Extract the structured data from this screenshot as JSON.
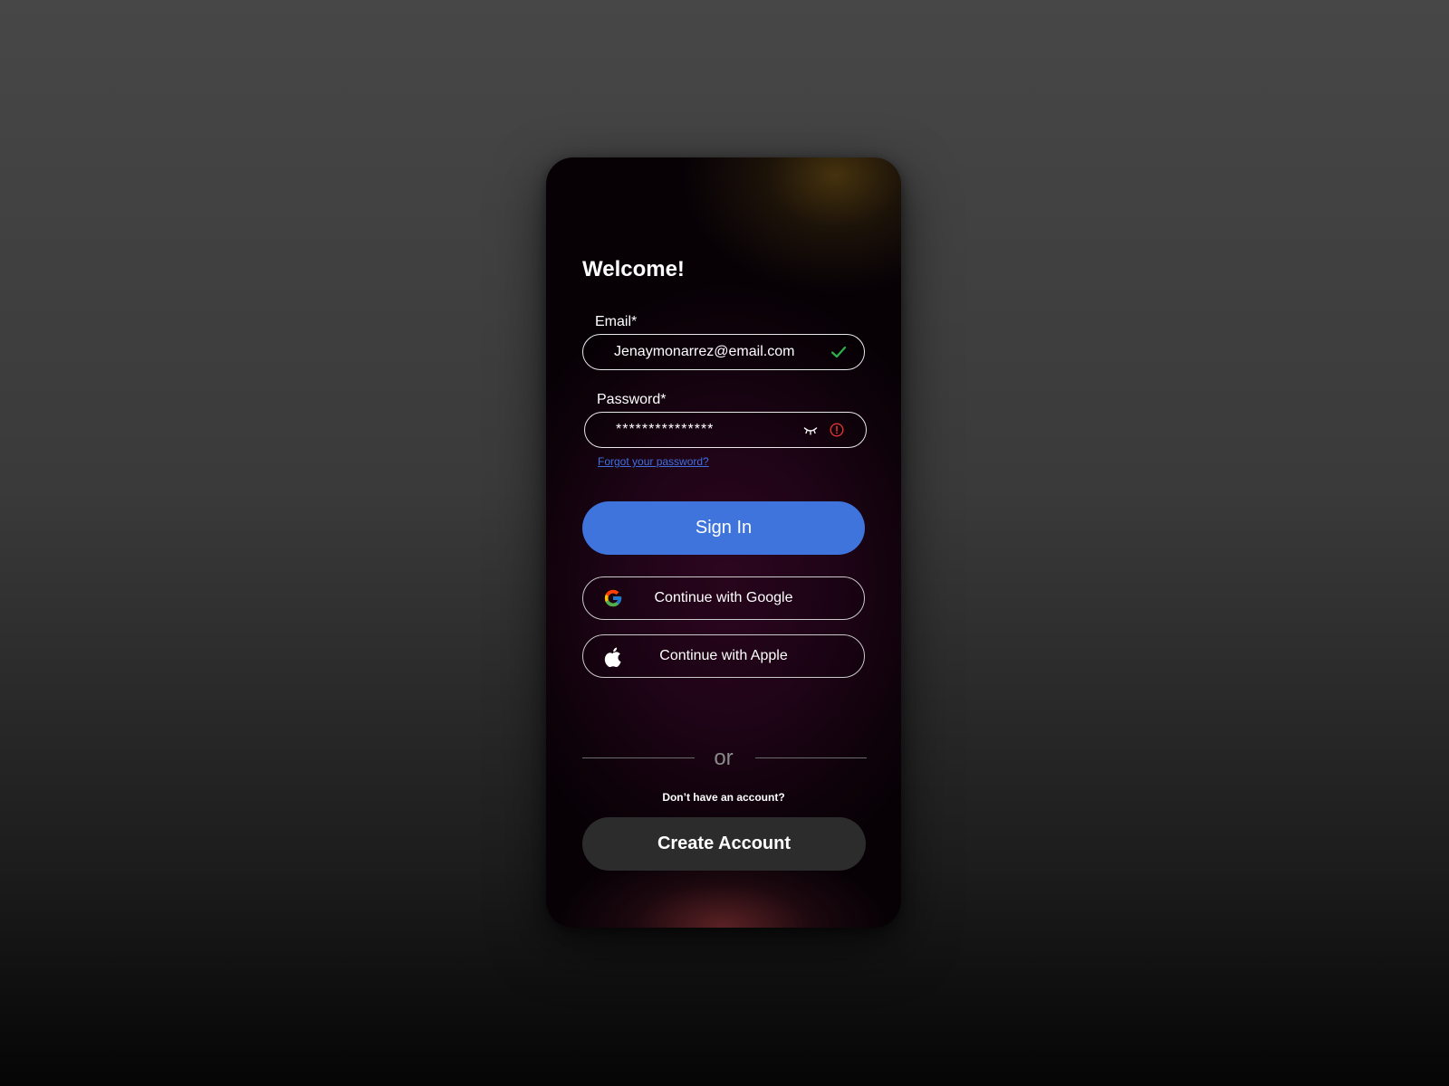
{
  "signin": {
    "title": "Welcome!",
    "email": {
      "label": "Email*",
      "value": "Jenaymonarrez@email.com",
      "status_icon": "check-icon",
      "status_color": "#2bb24c"
    },
    "password": {
      "label": "Password*",
      "value": "***************",
      "toggle_icon": "eye-closed-icon",
      "status_icon": "error-icon",
      "status_color": "#e0342f"
    },
    "forgot_password": "Forgot your password?",
    "sign_in_button": "Sign In",
    "google_button": "Continue with Google",
    "apple_button": "Continue with Apple",
    "divider_text": "or",
    "no_account_text": "Don’t have an account?",
    "create_account_button": "Create Account"
  },
  "colors": {
    "primary": "#3f74dd",
    "link": "#3f6fe0",
    "secondary_button": "#2c2c2c"
  }
}
